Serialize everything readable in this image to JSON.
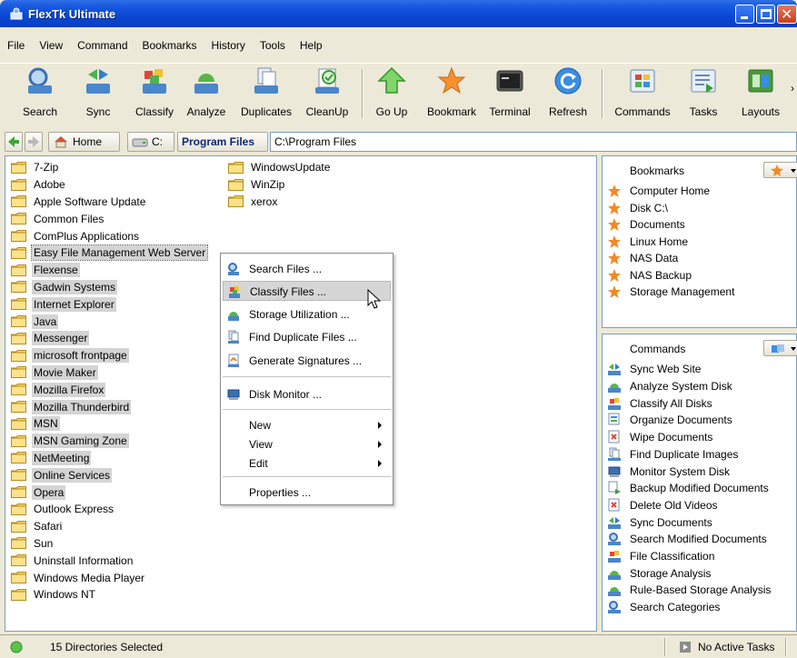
{
  "window": {
    "title": "FlexTk Ultimate"
  },
  "menu": [
    "File",
    "View",
    "Command",
    "Bookmarks",
    "History",
    "Tools",
    "Help"
  ],
  "toolbar": [
    {
      "label": "Search",
      "icon": "search-icon"
    },
    {
      "label": "Sync",
      "icon": "sync-icon"
    },
    {
      "label": "Classify",
      "icon": "classify-icon"
    },
    {
      "label": "Analyze",
      "icon": "analyze-icon"
    },
    {
      "label": "Duplicates",
      "icon": "duplicates-icon"
    },
    {
      "label": "CleanUp",
      "icon": "cleanup-icon"
    },
    {
      "label": "Go Up",
      "icon": "go-up-icon"
    },
    {
      "label": "Bookmark",
      "icon": "bookmark-star-icon"
    },
    {
      "label": "Terminal",
      "icon": "terminal-icon"
    },
    {
      "label": "Refresh",
      "icon": "refresh-icon"
    },
    {
      "label": "Commands",
      "icon": "commands-icon"
    },
    {
      "label": "Tasks",
      "icon": "tasks-icon"
    },
    {
      "label": "Layouts",
      "icon": "layouts-icon"
    }
  ],
  "address": {
    "crumbs": [
      "Home",
      "C:",
      "Program Files"
    ],
    "path": "C:\\Program Files"
  },
  "folders_col1": [
    {
      "name": "7-Zip",
      "selected": false
    },
    {
      "name": "Adobe",
      "selected": false
    },
    {
      "name": "Apple Software Update",
      "selected": false
    },
    {
      "name": "Common Files",
      "selected": false
    },
    {
      "name": "ComPlus Applications",
      "selected": false
    },
    {
      "name": "Easy File Management Web Server",
      "selected": true,
      "focus": true
    },
    {
      "name": "Flexense",
      "selected": true
    },
    {
      "name": "Gadwin Systems",
      "selected": true
    },
    {
      "name": "Internet Explorer",
      "selected": true
    },
    {
      "name": "Java",
      "selected": true
    },
    {
      "name": "Messenger",
      "selected": true
    },
    {
      "name": "microsoft frontpage",
      "selected": true
    },
    {
      "name": "Movie Maker",
      "selected": true
    },
    {
      "name": "Mozilla Firefox",
      "selected": true
    },
    {
      "name": "Mozilla Thunderbird",
      "selected": true
    },
    {
      "name": "MSN",
      "selected": true
    },
    {
      "name": "MSN Gaming Zone",
      "selected": true
    },
    {
      "name": "NetMeeting",
      "selected": true
    },
    {
      "name": "Online Services",
      "selected": true
    },
    {
      "name": "Opera",
      "selected": true
    },
    {
      "name": "Outlook Express",
      "selected": false
    },
    {
      "name": "Safari",
      "selected": false
    },
    {
      "name": "Sun",
      "selected": false
    },
    {
      "name": "Uninstall Information",
      "selected": false
    },
    {
      "name": "Windows Media Player",
      "selected": false
    },
    {
      "name": "Windows NT",
      "selected": false
    }
  ],
  "folders_col2": [
    {
      "name": "WindowsUpdate",
      "selected": false
    },
    {
      "name": "WinZip",
      "selected": false
    },
    {
      "name": "xerox",
      "selected": false
    }
  ],
  "context_menu": {
    "search": "Search Files ...",
    "classify": "Classify Files ...",
    "storage": "Storage Utilization ...",
    "duplicates": "Find Duplicate Files ...",
    "signatures": "Generate Signatures ...",
    "monitor": "Disk Monitor ...",
    "new": "New",
    "view": "View",
    "edit": "Edit",
    "properties": "Properties ..."
  },
  "bookmarks": {
    "title": "Bookmarks",
    "items": [
      "Computer Home",
      "Disk C:\\",
      "Documents",
      "Linux Home",
      "NAS Data",
      "NAS Backup",
      "Storage Management"
    ]
  },
  "commands": {
    "title": "Commands",
    "items": [
      {
        "label": "Sync Web Site",
        "icon": "sync"
      },
      {
        "label": "Analyze System Disk",
        "icon": "analyze"
      },
      {
        "label": "Classify All Disks",
        "icon": "classify"
      },
      {
        "label": "Organize Documents",
        "icon": "organize"
      },
      {
        "label": "Wipe Documents",
        "icon": "wipe"
      },
      {
        "label": "Find Duplicate Images",
        "icon": "duplicates"
      },
      {
        "label": "Monitor System Disk",
        "icon": "monitor"
      },
      {
        "label": "Backup Modified Documents",
        "icon": "backup"
      },
      {
        "label": "Delete Old Videos",
        "icon": "wipe"
      },
      {
        "label": "Sync Documents",
        "icon": "sync"
      },
      {
        "label": "Search Modified Documents",
        "icon": "search"
      },
      {
        "label": "File Classification",
        "icon": "classify"
      },
      {
        "label": "Storage Analysis",
        "icon": "analyze"
      },
      {
        "label": "Rule-Based Storage Analysis",
        "icon": "analyze"
      },
      {
        "label": "Search Categories",
        "icon": "search"
      }
    ]
  },
  "status": {
    "selection": "15 Directories Selected",
    "tasks": "No Active Tasks"
  },
  "colors": {
    "title_bar": "#0a47d2",
    "selection": "#d4d4d4",
    "folder": "#f5d56a",
    "star": "#f08a24"
  }
}
